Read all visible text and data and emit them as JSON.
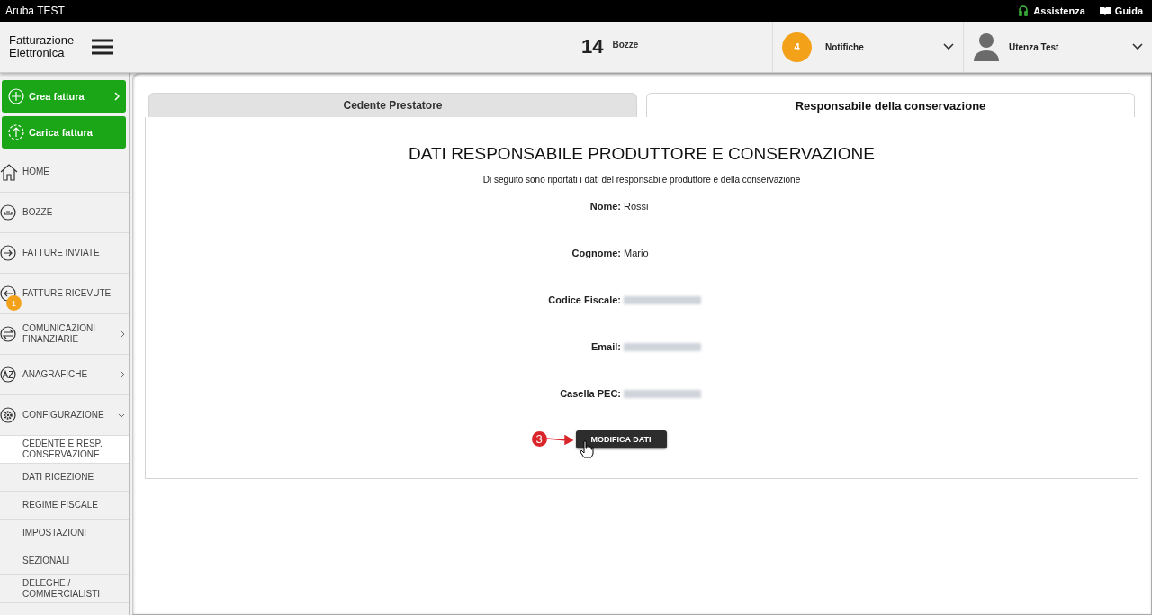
{
  "topbar": {
    "title": "Aruba TEST",
    "links": [
      {
        "kind": "support",
        "label": "Assistenza"
      },
      {
        "kind": "guide",
        "label": "Guida"
      }
    ]
  },
  "header": {
    "logo_lines": [
      "Fatturazione",
      "Elettronica"
    ],
    "drafts": {
      "count": "14",
      "label": "Bozze"
    },
    "notifications": {
      "count": "4",
      "label": "Notifiche"
    },
    "user": {
      "name": "Utenza Test"
    }
  },
  "sidebar": {
    "actions": [
      {
        "kind": "create",
        "label": "Crea fattura"
      },
      {
        "kind": "upload",
        "label": "Carica fattura"
      }
    ],
    "items": [
      {
        "kind": "home",
        "label": "HOME"
      },
      {
        "kind": "drafts",
        "label": "BOZZE"
      },
      {
        "kind": "sent",
        "label": "FATTURE INVIATE"
      },
      {
        "kind": "received",
        "label": "FATTURE RICEVUTE",
        "badge": "1"
      },
      {
        "kind": "exchange",
        "label": "COMUNICAZIONI FINANZIARIE"
      },
      {
        "kind": "registry",
        "label": "ANAGRAFICHE"
      },
      {
        "kind": "settings",
        "label": "CONFIGURAZIONE",
        "children": [
          {
            "label": "CEDENTE E RESP. CONSERVAZIONE",
            "selected": true
          },
          {
            "label": "DATI RICEZIONE",
            "selected": false
          },
          {
            "label": "REGIME FISCALE",
            "selected": false
          },
          {
            "label": "IMPOSTAZIONI",
            "selected": false
          },
          {
            "label": "SEZIONALI",
            "selected": false
          },
          {
            "label": "DELEGHE / COMMERCIALISTI",
            "selected": false
          }
        ]
      }
    ]
  },
  "tabs": [
    {
      "label": "Cedente Prestatore",
      "selected": false
    },
    {
      "label": "Responsabile della conservazione",
      "selected": true
    }
  ],
  "panel": {
    "heading": "DATI RESPONSABILE PRODUTTORE E CONSERVAZIONE",
    "subtitle": "Di seguito sono riportati i dati del responsabile produttore e della conservazione",
    "fields": [
      {
        "kind": "plain",
        "label": "Nome:",
        "value": "Rossi"
      },
      {
        "kind": "plain",
        "label": "Cognome:",
        "value": "Mario"
      },
      {
        "kind": "redacted",
        "label": "Codice Fiscale:"
      },
      {
        "kind": "redacted",
        "label": "Email:"
      },
      {
        "kind": "redacted",
        "label": "Casella PEC:"
      }
    ],
    "button": "MODIFICA DATI",
    "annotation": {
      "step": "3"
    }
  }
}
